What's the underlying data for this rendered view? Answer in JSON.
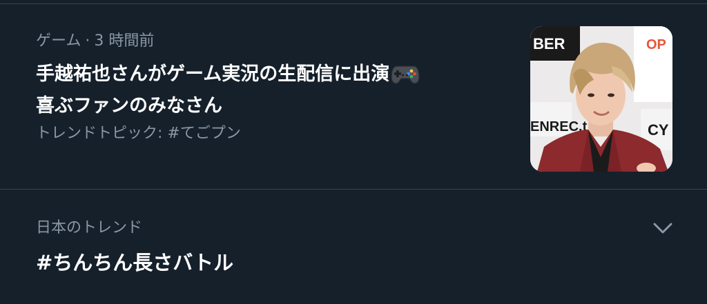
{
  "trend_card": {
    "category": "ゲーム",
    "separator": "·",
    "time_ago": "3 時間前",
    "headline_line1": "手越祐也さんがゲーム実況の生配信に出演",
    "headline_line2": "喜ぶファンのみなさん",
    "headline_emoji": "gamepad-icon",
    "topic_label": "トレンドトピック: #てごプン",
    "thumbnail": {
      "backdrop_text_1": "BER",
      "backdrop_text_2": "OP",
      "backdrop_text_3": "ENREC.t",
      "backdrop_text_4": "CY"
    }
  },
  "trend_item": {
    "region_label": "日本のトレンド",
    "hashtag": "#ちんちん長さバトル",
    "more_icon": "chevron-down-icon"
  },
  "colors": {
    "background": "#15202b",
    "divider": "#38444d",
    "primary_text": "#ffffff",
    "secondary_text": "#8b98a5",
    "chevron": "#8b98a5"
  }
}
